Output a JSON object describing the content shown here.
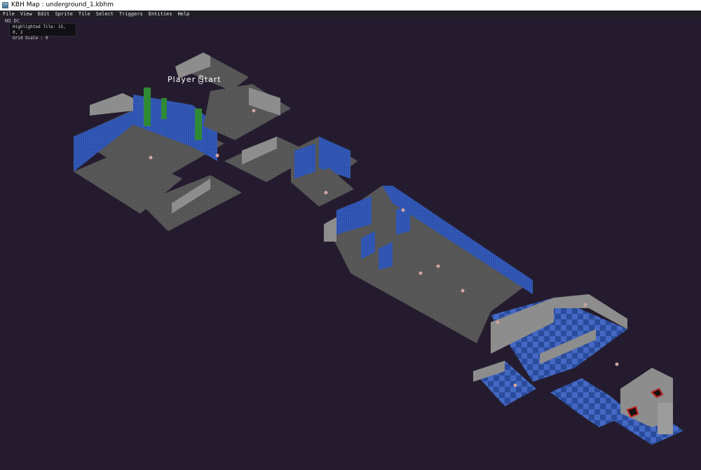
{
  "window": {
    "title": "KBH Map : underground_1.kbhm",
    "icon": "map-app-icon"
  },
  "menu": {
    "items": [
      "File",
      "View",
      "Edit",
      "Sprite",
      "Tile",
      "Select",
      "Triggers",
      "Entities",
      "Help"
    ]
  },
  "overlay": {
    "fps": "NO DC",
    "highlighted_tile": "Highlighted Tile: 15, 0, 2",
    "grid_scale": "Grid Scale : 0"
  },
  "map": {
    "player_start_label": "Player Start",
    "colors": {
      "background": "#241c2e",
      "floor": "#5a5a5a",
      "wall_gray": "#8d8d8d",
      "wall_blue": "#2f55b5",
      "checker_dark": "#2a4c9c",
      "checker_light": "#4468c4",
      "vegetation": "#2f8a35"
    }
  }
}
